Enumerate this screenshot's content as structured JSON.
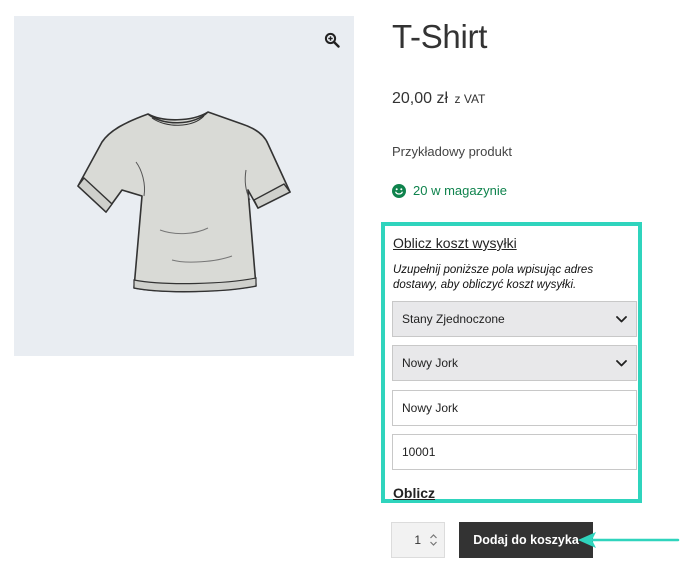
{
  "product": {
    "title": "T-Shirt",
    "price": "20,00 zł",
    "price_suffix": "z VAT",
    "short_description": "Przykładowy produkt",
    "stock": "20 w magazynie"
  },
  "icons": {
    "zoom": "zoom-in-icon",
    "stock": "smiley-icon",
    "select": "chevron-down-icon",
    "stepper": "up-down-stepper-icon",
    "annotation": "arrow-left-icon"
  },
  "shipping_calculator": {
    "toggle_label": "Oblicz koszt wysyłki",
    "hint": "Uzupełnij poniższe pola wpisując adres dostawy, aby obliczyć koszt wysyłki.",
    "country": "Stany Zjednoczone",
    "state": "Nowy Jork",
    "city": "Nowy Jork",
    "postcode": "10001",
    "submit_label": "Oblicz"
  },
  "cart": {
    "quantity": "1",
    "add_to_cart_label": "Dodaj do koszyka"
  },
  "colors": {
    "highlight": "#2fd4bd",
    "in_stock": "#0f834d",
    "button_bg": "#333333"
  }
}
